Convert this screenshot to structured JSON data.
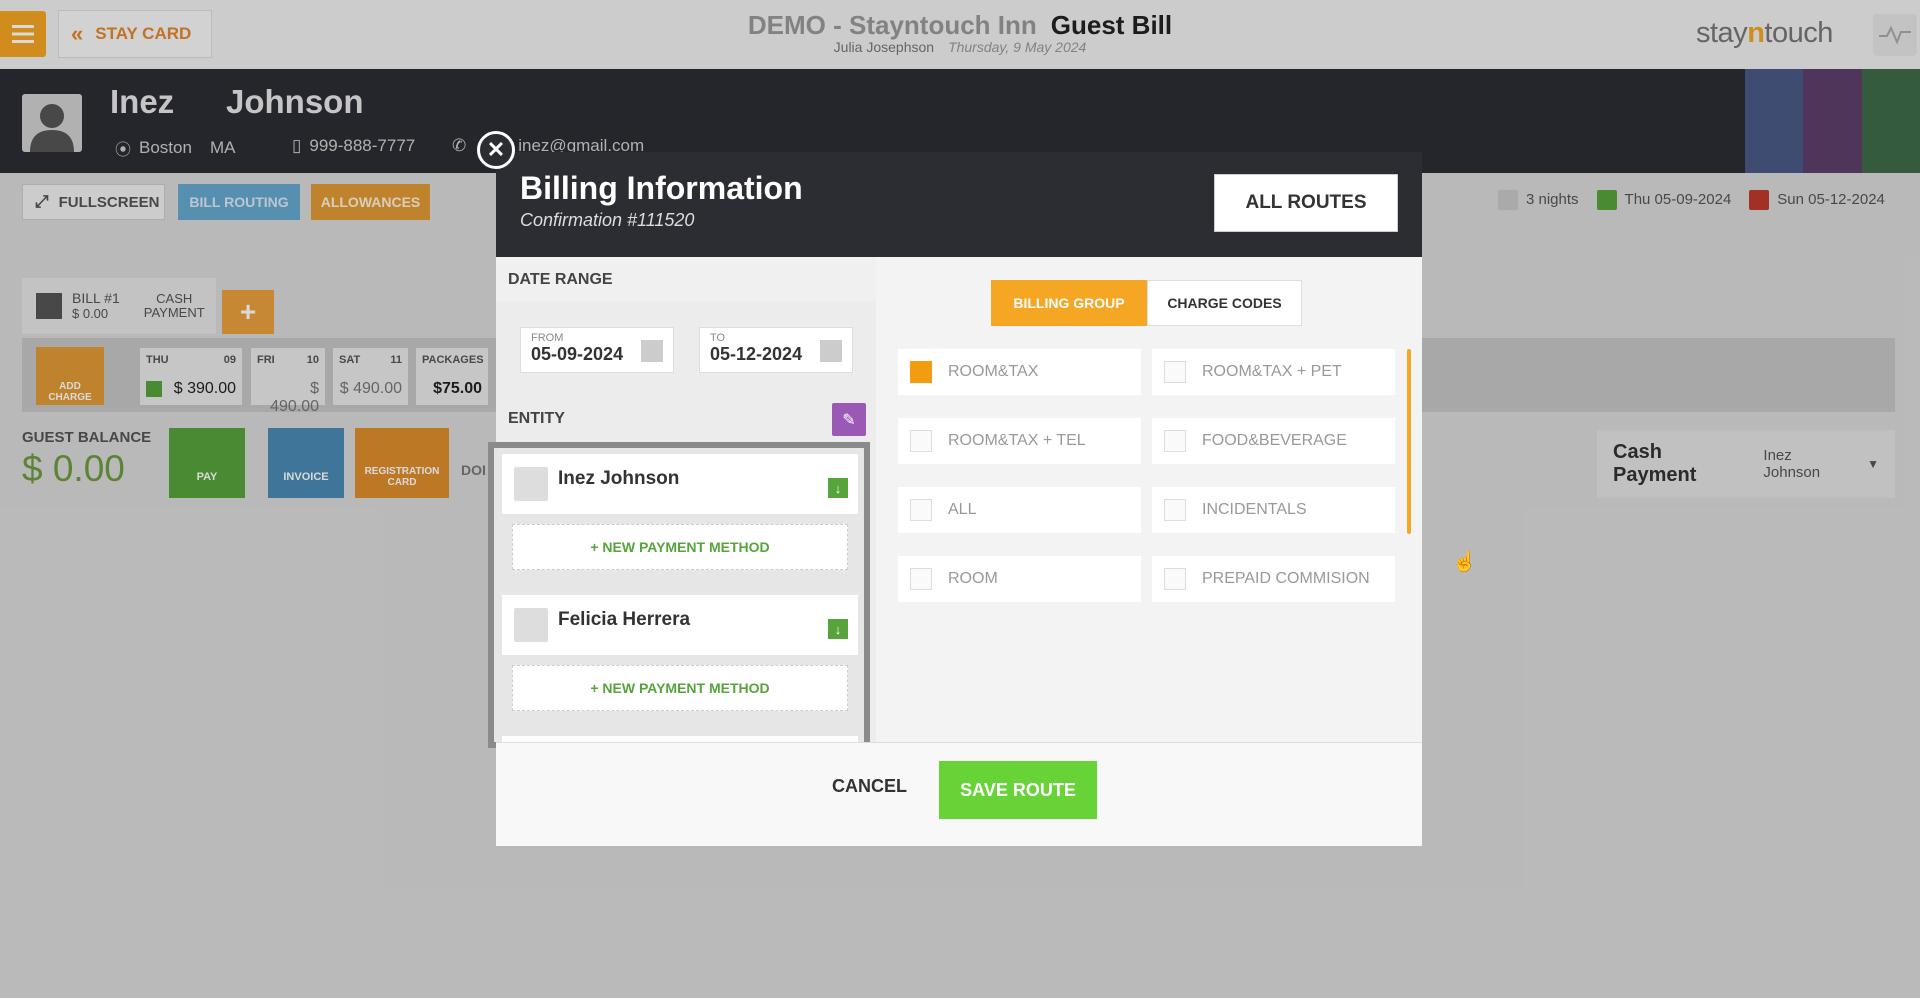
{
  "top_bar": {
    "stay_card_label": "STAY CARD",
    "hotel": "DEMO - Stayntouch Inn",
    "page_title": "Guest Bill",
    "user": "Julia Josephson",
    "date": "Thursday, 9 May 2024",
    "brand_pre": "stay",
    "brand_n": "n",
    "brand_post": "touch"
  },
  "guest": {
    "first_name": "Inez",
    "last_name": "Johnson",
    "city": "Boston",
    "state": "MA",
    "phone": "999-888-7777",
    "email": "inez@gmail.com"
  },
  "toolbar": {
    "fullscreen": "FULLSCREEN",
    "bill_routing": "BILL ROUTING",
    "allowances": "ALLOWANCES"
  },
  "stay": {
    "nights": "3 nights",
    "arrival": "Thu 05-09-2024",
    "departure": "Sun 05-12-2024"
  },
  "bill": {
    "bill_label": "BILL #1",
    "bill_amount": "$ 0.00",
    "bill_type_line1": "CASH",
    "bill_type_line2": "PAYMENT",
    "add_charge_line1": "ADD",
    "add_charge_line2": "CHARGE",
    "days": [
      {
        "day": "THU",
        "num": "09",
        "amount": "$ 390.00"
      },
      {
        "day": "FRI",
        "num": "10",
        "amount": "$ 490.00"
      },
      {
        "day": "SAT",
        "num": "11",
        "amount": "$ 490.00"
      },
      {
        "day": "PACKAGES",
        "num": "",
        "amount": "$75.00"
      }
    ],
    "guest_balance_label": "GUEST BALANCE",
    "guest_balance": "$ 0.00",
    "pay": "PAY",
    "invoice": "INVOICE",
    "registration_line1": "REGISTRATION",
    "registration_line2": "CARD",
    "dot_text": "DOI"
  },
  "cash_panel": {
    "title": "Cash Payment",
    "guest": "Inez Johnson"
  },
  "modal": {
    "title": "Billing Information",
    "confirmation": "Confirmation #111520",
    "all_routes": "ALL ROUTES",
    "date_range_label": "DATE RANGE",
    "from_label": "FROM",
    "from_value": "05-09-2024",
    "to_label": "TO",
    "to_value": "05-12-2024",
    "entity_label": "ENTITY",
    "entities": [
      {
        "name": "Inez Johnson",
        "new_payment": "+ NEW PAYMENT METHOD"
      },
      {
        "name": "Felicia Herrera",
        "new_payment": "+ NEW PAYMENT METHOD"
      }
    ],
    "tabs": {
      "billing_group": "BILLING GROUP",
      "charge_codes": "CHARGE CODES"
    },
    "billing_groups": [
      {
        "label": "ROOM&TAX",
        "checked": true
      },
      {
        "label": "ROOM&TAX + PET",
        "checked": false
      },
      {
        "label": "ROOM&TAX + TEL",
        "checked": false
      },
      {
        "label": "FOOD&BEVERAGE",
        "checked": false
      },
      {
        "label": "ALL",
        "checked": false
      },
      {
        "label": "INCIDENTALS",
        "checked": false
      },
      {
        "label": "ROOM",
        "checked": false
      },
      {
        "label": "PREPAID COMMISION",
        "checked": false
      }
    ],
    "cancel": "CANCEL",
    "save_route": "SAVE ROUTE"
  },
  "colors": {
    "accent_orange": "#f5a623",
    "save_green": "#67d337",
    "header_dark": "#2b2d33",
    "balance_green": "#6c9c3f"
  },
  "icons": [
    "menu-icon",
    "double-chevron-left-icon",
    "avatar-icon",
    "location-pin-icon",
    "mobile-phone-icon",
    "phone-icon",
    "close-icon",
    "fullscreen-icon",
    "moon-icon",
    "arrow-down-icon",
    "arrow-up-icon",
    "calendar-icon",
    "pencil-icon",
    "download-icon",
    "plus-icon",
    "cursor-hand-icon"
  ]
}
